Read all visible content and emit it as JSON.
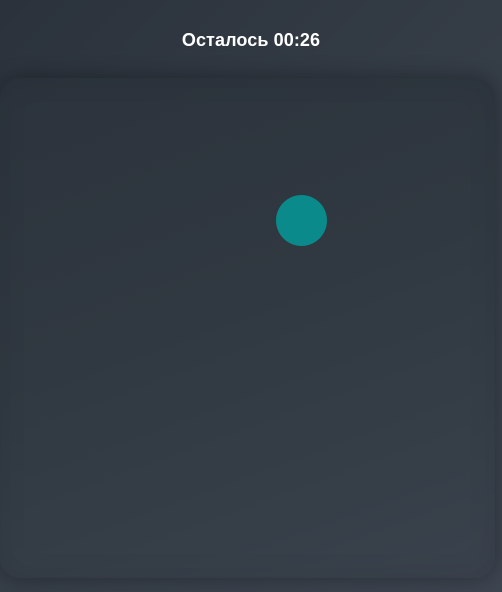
{
  "header": {
    "timer_text": "Осталось 00:26"
  },
  "colors": {
    "background": "#353c46",
    "game_area": "#303841",
    "target": "#0a8a8a",
    "text": "#ffffff"
  },
  "game_area": {
    "target": {
      "icon": "teal-circle"
    }
  }
}
